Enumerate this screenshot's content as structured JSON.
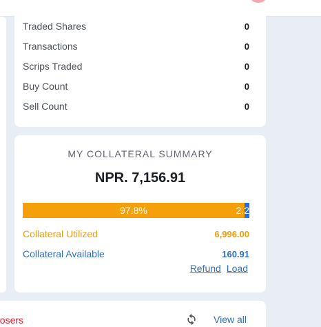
{
  "stats": [
    {
      "label": "Traded Shares",
      "value": "0"
    },
    {
      "label": "Transactions",
      "value": "0"
    },
    {
      "label": "Scrips Traded",
      "value": "0"
    },
    {
      "label": "Buy Count",
      "value": "0"
    },
    {
      "label": "Sell Count",
      "value": "0"
    }
  ],
  "collateral": {
    "title": "MY COLLATERAL SUMMARY",
    "amount": "NPR. 7,156.91",
    "utilized_pct": 97.8,
    "utilized_pct_label": "97.8%",
    "available_pct_label": "2.2",
    "utilized_label": "Collateral Utilized",
    "utilized_value": "6,996.00",
    "available_label": "Collateral Available",
    "available_value": "160.91",
    "refund_label": "Refund",
    "load_label": "Load"
  },
  "losers": {
    "label": "Losers",
    "refresh_icon": "refresh-icon",
    "view_all_label": "View all"
  },
  "colors": {
    "utilized": "#f5a00b",
    "available": "#2a6fd0",
    "losers": "#e0192b",
    "link": "#2f6fbf"
  }
}
